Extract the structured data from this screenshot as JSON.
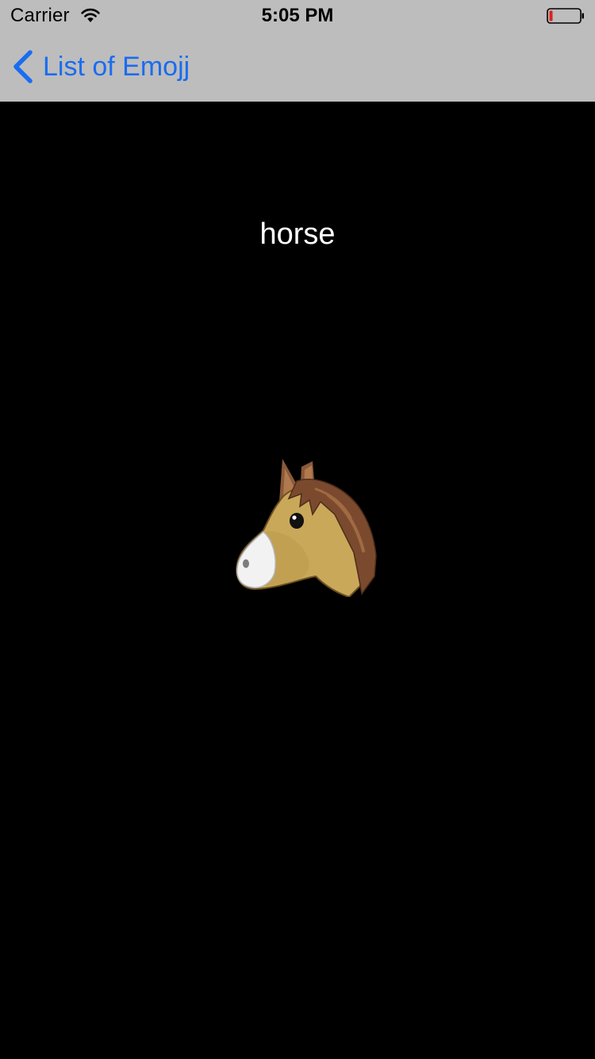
{
  "status_bar": {
    "carrier": "Carrier",
    "time": "5:05 PM",
    "wifi_icon": "wifi-icon",
    "battery_icon": "battery-low-icon",
    "battery_color": "#e0201e"
  },
  "nav_bar": {
    "back_label": "List of Emojj",
    "back_icon": "chevron-left-icon",
    "accent_color": "#1a6cf0"
  },
  "content": {
    "emoji_name": "horse",
    "emoji_icon": "horse-face-icon"
  }
}
